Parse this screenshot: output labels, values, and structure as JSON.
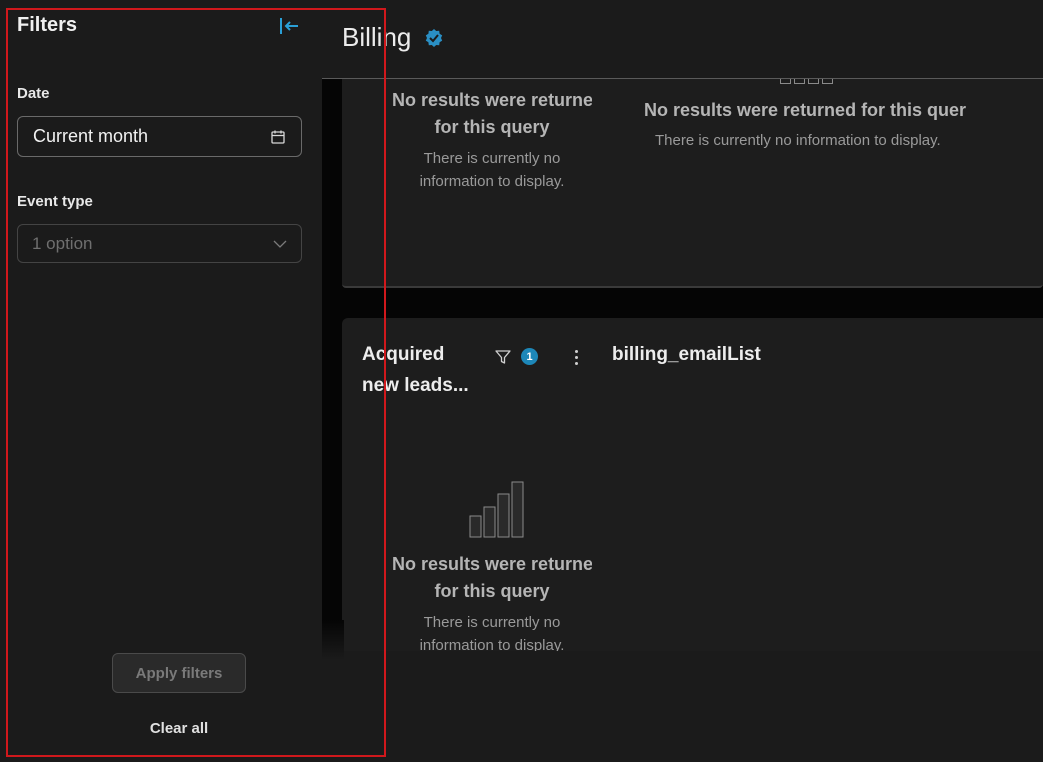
{
  "sidebar": {
    "title": "Filters",
    "date_label": "Date",
    "date_value": "Current month",
    "event_type_label": "Event type",
    "event_type_value": "1 option",
    "apply_label": "Apply filters",
    "clear_label": "Clear all",
    "icons": {
      "collapse": "collapse-left-icon",
      "calendar": "calendar-icon",
      "chevron": "chevron-down-icon"
    }
  },
  "header": {
    "title": "Billing",
    "verified_icon": "verified-badge-icon"
  },
  "widgets": [
    {
      "empty_head_line1": "No results were returne",
      "empty_head_line2": "for this query",
      "empty_sub_line1": "There is currently no",
      "empty_sub_line2": "information to display."
    },
    {
      "empty_head": "No results were returned for this query",
      "empty_sub": "There is currently no information to display."
    },
    {
      "title_line1": "Acquired",
      "title_line2": "new leads...",
      "filter_count": "1",
      "empty_head_line1": "No results were returne",
      "empty_head_line2": "for this query",
      "empty_sub_line1": "There is currently no",
      "empty_sub_line2": "information to display."
    },
    {
      "title": "billing_emailList"
    }
  ],
  "colors": {
    "accent": "#1d87b8",
    "highlight_border": "#d0181c",
    "background": "#1b1b1b"
  }
}
